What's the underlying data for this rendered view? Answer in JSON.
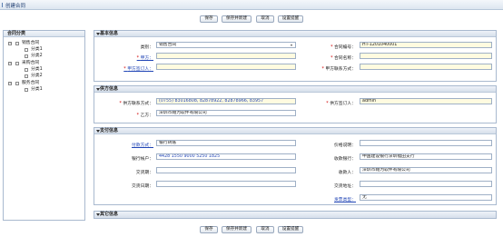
{
  "title": "创建合同",
  "toolbar": {
    "save": "保存",
    "save_new": "保存并新建",
    "cancel": "取消",
    "remind": "设置提醒"
  },
  "sidebar": {
    "header": "合同分类",
    "groups": [
      {
        "label": "销售合同",
        "children": [
          "分类1",
          "分类2"
        ]
      },
      {
        "label": "采购合同",
        "children": [
          "分类1",
          "分类2"
        ]
      },
      {
        "label": "服务合同",
        "children": [
          "分类1"
        ]
      }
    ]
  },
  "basic": {
    "header": "基本信息",
    "type_label": "类别：",
    "type_value": "销售合同",
    "party_a_label": "甲方：",
    "party_a_signer_label": "甲方签订人：",
    "contract_no_label": "合同编号：",
    "contract_no_value": "HT-1201040001",
    "contract_name_label": "合同名称：",
    "party_a_contact_label": "甲方联系方式："
  },
  "supplier": {
    "header": "供方信息",
    "contact_label": "供方联系方式：",
    "contact_value": "(0755) 83016808, 82878922, 82878966, 83957",
    "party_b_label": "乙方：",
    "party_b_value": "深圳市翱为软件有限公司",
    "signer_label": "供方签订人：",
    "signer_value": "admin"
  },
  "payment": {
    "header": "支付信息",
    "method_label": "付款方式：",
    "method_value": "银行转账",
    "account_label": "银行帐户：",
    "account_value": "4428 1550 9000 5250 1825",
    "phone_label": "交货期：",
    "deliver_date_label": "交货日期：",
    "price_label": "价格说明：",
    "bank_label": "收款银行：",
    "bank_value": "中国建设银行深圳福田支行",
    "payee_label": "收款人：",
    "payee_value": "深圳市翱为软件有限公司",
    "address_label": "交货地址：",
    "invoice_label": "发票类型：",
    "invoice_value": "无"
  },
  "other": {
    "header": "其它信息"
  }
}
